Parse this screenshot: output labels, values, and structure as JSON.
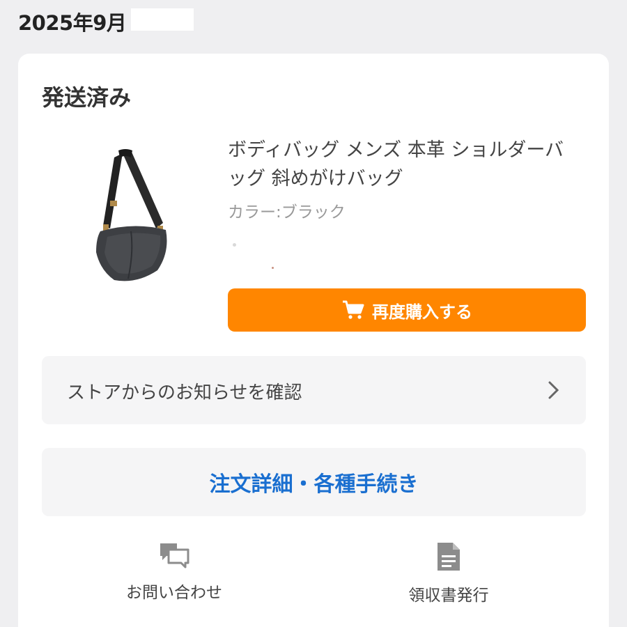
{
  "header": {
    "date": "2025年9月"
  },
  "order": {
    "status": "発送済み",
    "product": {
      "name": "ボディバッグ メンズ 本革 ショルダーバッグ 斜めがけバッグ",
      "color": "カラー:ブラック",
      "image_icon": "black-leather-shoulder-bag"
    },
    "rebuy_button": {
      "label": "再度購入する",
      "icon": "cart-icon",
      "color": "#ff8600"
    },
    "store_notice": {
      "label": "ストアからのお知らせを確認",
      "icon": "chevron-right-icon"
    },
    "detail_button": {
      "label": "注文詳細・各種手続き",
      "color": "#1a6fd0"
    },
    "actions": [
      {
        "label": "お問い合わせ",
        "icon": "chat-bubbles-icon"
      },
      {
        "label": "領収書発行",
        "icon": "document-icon"
      }
    ]
  }
}
